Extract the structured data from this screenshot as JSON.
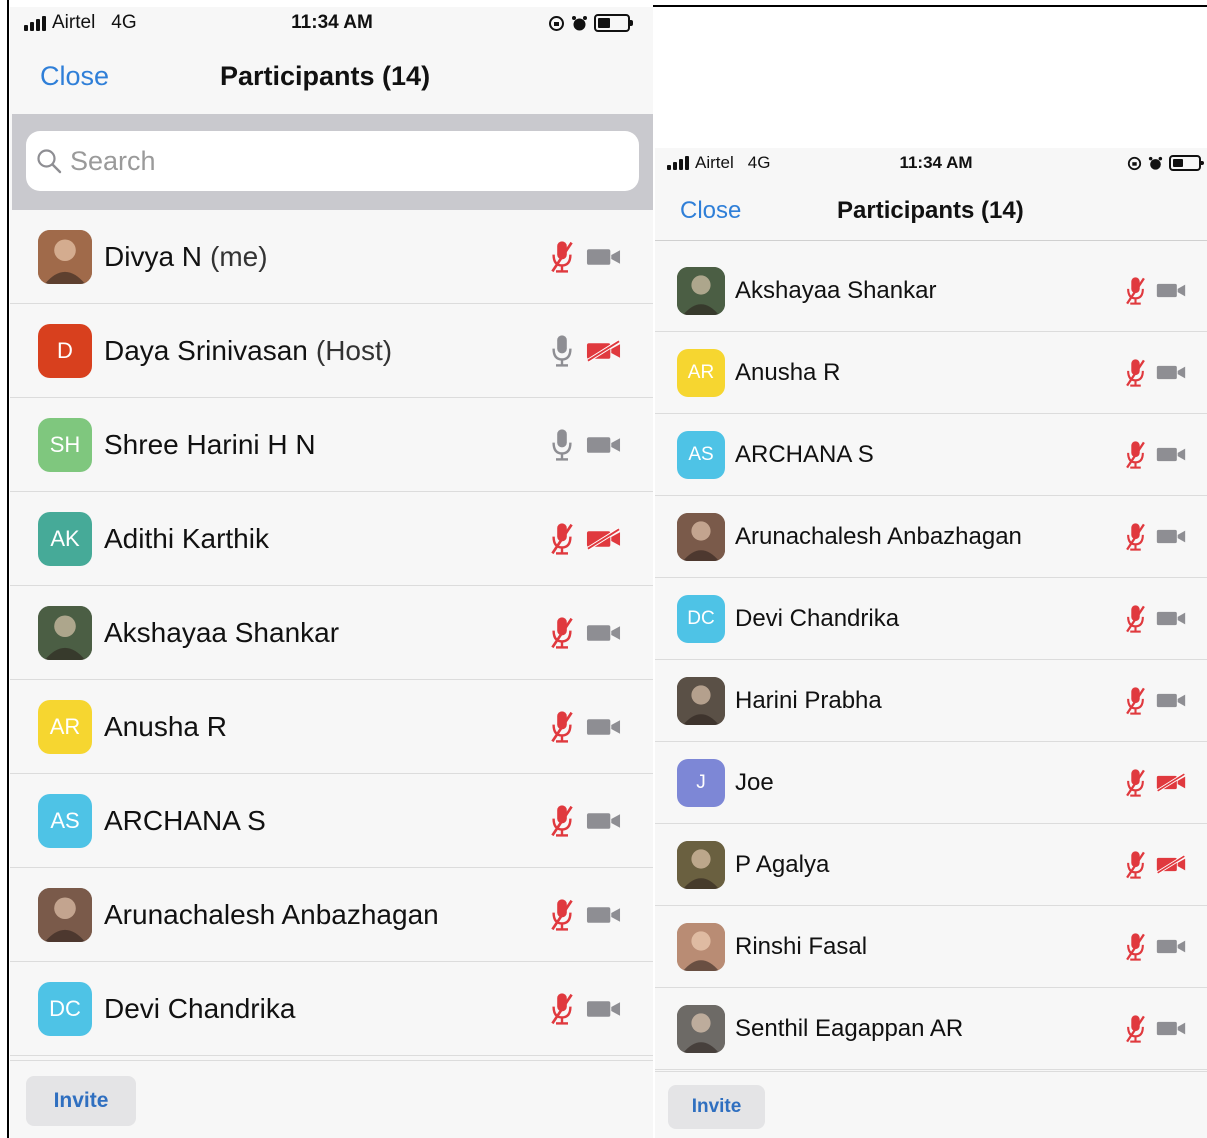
{
  "status": {
    "carrier": "Airtel",
    "network": "4G",
    "time": "11:34 AM"
  },
  "header": {
    "close_label": "Close",
    "title": "Participants (14)"
  },
  "search": {
    "placeholder": "Search"
  },
  "footer": {
    "invite_label": "Invite"
  },
  "colors": {
    "accent": "#2f7fd8",
    "muted_red": "#e0393e",
    "icon_gray": "#8e8e93"
  },
  "left_screen": {
    "participants": [
      {
        "name": "Divya N",
        "role": "(me)",
        "avatar_type": "photo",
        "avatar_color": "#a06a4a",
        "mic": "muted",
        "video": "on"
      },
      {
        "name": "Daya Srinivasan",
        "role": "(Host)",
        "avatar_type": "initials",
        "initials": "D",
        "avatar_color": "#d8401e",
        "mic": "on",
        "video": "off"
      },
      {
        "name": "Shree Harini H N",
        "role": "",
        "avatar_type": "initials",
        "initials": "SH",
        "avatar_color": "#7fc77e",
        "mic": "on",
        "video": "on"
      },
      {
        "name": "Adithi Karthik",
        "role": "",
        "avatar_type": "initials",
        "initials": "AK",
        "avatar_color": "#46aa98",
        "mic": "muted",
        "video": "off"
      },
      {
        "name": "Akshayaa Shankar",
        "role": "",
        "avatar_type": "photo",
        "avatar_color": "#4b5e44",
        "mic": "muted",
        "video": "on"
      },
      {
        "name": "Anusha R",
        "role": "",
        "avatar_type": "initials",
        "initials": "AR",
        "avatar_color": "#f6d630",
        "mic": "muted",
        "video": "on"
      },
      {
        "name": "ARCHANA S",
        "role": "",
        "avatar_type": "initials",
        "initials": "AS",
        "avatar_color": "#4ec3e6",
        "mic": "muted",
        "video": "on"
      },
      {
        "name": "Arunachalesh Anbazhagan",
        "role": "",
        "avatar_type": "photo",
        "avatar_color": "#7a5a4a",
        "mic": "muted",
        "video": "on"
      },
      {
        "name": "Devi Chandrika",
        "role": "",
        "avatar_type": "initials",
        "initials": "DC",
        "avatar_color": "#4ec3e6",
        "mic": "muted",
        "video": "on"
      }
    ]
  },
  "right_screen": {
    "participants": [
      {
        "name": "Akshayaa Shankar",
        "role": "",
        "avatar_type": "photo",
        "avatar_color": "#4b5e44",
        "mic": "muted",
        "video": "on"
      },
      {
        "name": "Anusha R",
        "role": "",
        "avatar_type": "initials",
        "initials": "AR",
        "avatar_color": "#f6d630",
        "mic": "muted",
        "video": "on"
      },
      {
        "name": "ARCHANA S",
        "role": "",
        "avatar_type": "initials",
        "initials": "AS",
        "avatar_color": "#4ec3e6",
        "mic": "muted",
        "video": "on"
      },
      {
        "name": "Arunachalesh Anbazhagan",
        "role": "",
        "avatar_type": "photo",
        "avatar_color": "#7a5a4a",
        "mic": "muted",
        "video": "on"
      },
      {
        "name": "Devi Chandrika",
        "role": "",
        "avatar_type": "initials",
        "initials": "DC",
        "avatar_color": "#4ec3e6",
        "mic": "muted",
        "video": "on"
      },
      {
        "name": "Harini Prabha",
        "role": "",
        "avatar_type": "photo",
        "avatar_color": "#5a5046",
        "mic": "muted",
        "video": "on"
      },
      {
        "name": "Joe",
        "role": "",
        "avatar_type": "initials",
        "initials": "J",
        "avatar_color": "#7d87d6",
        "mic": "muted",
        "video": "off"
      },
      {
        "name": "P Agalya",
        "role": "",
        "avatar_type": "photo",
        "avatar_color": "#6a6040",
        "mic": "muted",
        "video": "off"
      },
      {
        "name": "Rinshi Fasal",
        "role": "",
        "avatar_type": "photo",
        "avatar_color": "#b98c74",
        "mic": "muted",
        "video": "on"
      },
      {
        "name": "Senthil Eagappan AR",
        "role": "",
        "avatar_type": "photo",
        "avatar_color": "#6d6a66",
        "mic": "muted",
        "video": "on"
      }
    ]
  }
}
